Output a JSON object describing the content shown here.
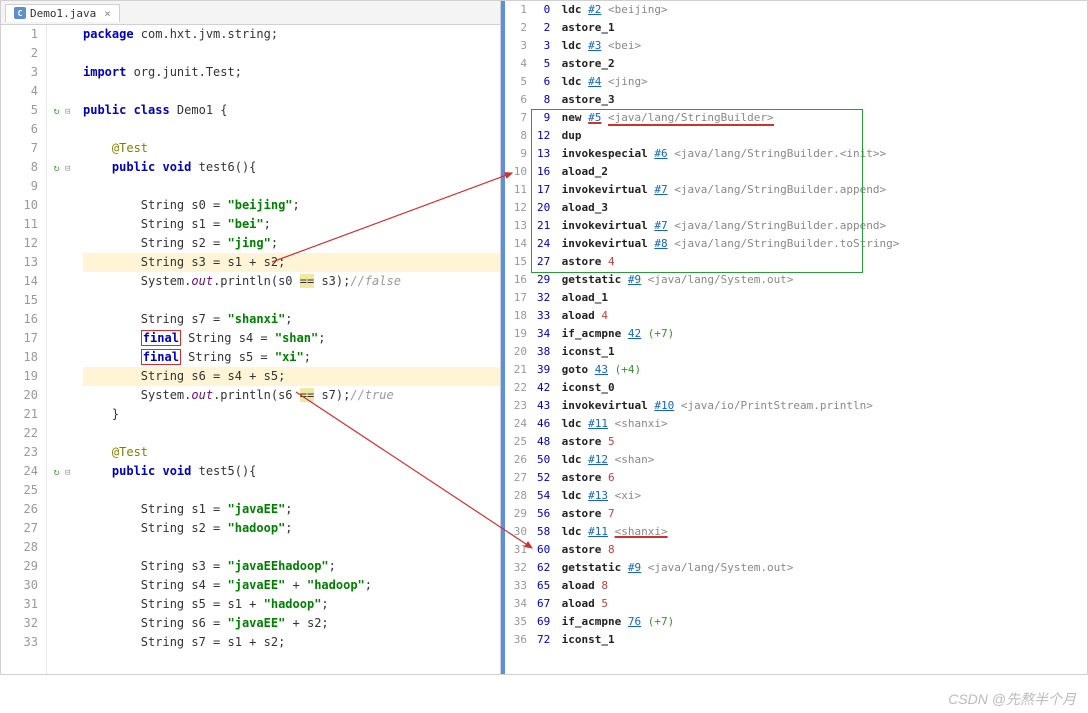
{
  "tab": {
    "filename": "Demo1.java"
  },
  "code": {
    "lines": [
      {
        "n": 1,
        "t": [
          [
            "kw",
            "package "
          ],
          [
            "",
            "com.hxt.jvm.string;"
          ]
        ]
      },
      {
        "n": 2,
        "t": [
          [
            "",
            ""
          ]
        ]
      },
      {
        "n": 3,
        "t": [
          [
            "kw",
            "import "
          ],
          [
            "",
            "org.junit.Test;"
          ]
        ]
      },
      {
        "n": 4,
        "t": [
          [
            "",
            ""
          ]
        ]
      },
      {
        "n": 5,
        "t": [
          [
            "kw",
            "public class "
          ],
          [
            "",
            "Demo1 {"
          ]
        ],
        "svc": true,
        "fold": true
      },
      {
        "n": 6,
        "t": [
          [
            "",
            ""
          ]
        ]
      },
      {
        "n": 7,
        "t": [
          [
            "",
            "    "
          ],
          [
            "ann",
            "@Test"
          ]
        ]
      },
      {
        "n": 8,
        "t": [
          [
            "",
            "    "
          ],
          [
            "kw",
            "public void "
          ],
          [
            "",
            "test6(){"
          ]
        ],
        "svc": true,
        "fold": true
      },
      {
        "n": 9,
        "t": [
          [
            "",
            ""
          ]
        ]
      },
      {
        "n": 10,
        "t": [
          [
            "",
            "        String s0 = "
          ],
          [
            "str",
            "\"beijing\""
          ],
          [
            "",
            ";"
          ]
        ]
      },
      {
        "n": 11,
        "t": [
          [
            "",
            "        String s1 = "
          ],
          [
            "str",
            "\"bei\""
          ],
          [
            "",
            ";"
          ]
        ]
      },
      {
        "n": 12,
        "t": [
          [
            "",
            "        String s2 = "
          ],
          [
            "str",
            "\"jing\""
          ],
          [
            "",
            ";"
          ]
        ]
      },
      {
        "n": 13,
        "t": [
          [
            "",
            "        String s3 = s1 + s2;"
          ]
        ],
        "hl": true
      },
      {
        "n": 14,
        "t": [
          [
            "",
            "        System."
          ],
          [
            "static-ita",
            "out"
          ],
          [
            "",
            ".println(s0 "
          ],
          [
            "eq",
            "=="
          ],
          [
            "",
            "",
            " s3);"
          ],
          [
            "comment",
            "//false"
          ]
        ]
      },
      {
        "n": 15,
        "t": [
          [
            "",
            ""
          ]
        ]
      },
      {
        "n": 16,
        "t": [
          [
            "",
            "        String s7 = "
          ],
          [
            "str",
            "\"shanxi\""
          ],
          [
            "",
            ";"
          ]
        ]
      },
      {
        "n": 17,
        "t": [
          [
            "",
            "        "
          ],
          [
            "finalbox",
            "final"
          ],
          [
            "",
            "",
            " String s4 = "
          ],
          [
            "str",
            "\"shan\""
          ],
          [
            "",
            ";"
          ]
        ]
      },
      {
        "n": 18,
        "t": [
          [
            "",
            "        "
          ],
          [
            "finalbox",
            "final"
          ],
          [
            "",
            "",
            " String s5 = "
          ],
          [
            "str",
            "\"xi\""
          ],
          [
            "",
            ";"
          ]
        ]
      },
      {
        "n": 19,
        "t": [
          [
            "",
            "        String s6 = s4 + s5;"
          ]
        ],
        "hl": true
      },
      {
        "n": 20,
        "t": [
          [
            "",
            "        System."
          ],
          [
            "static-ita",
            "out"
          ],
          [
            "",
            ".println(s6 "
          ],
          [
            "eq",
            "=="
          ],
          [
            "",
            "",
            " s7);"
          ],
          [
            "comment",
            "//true"
          ]
        ]
      },
      {
        "n": 21,
        "t": [
          [
            "",
            "    }"
          ]
        ]
      },
      {
        "n": 22,
        "t": [
          [
            "",
            ""
          ]
        ]
      },
      {
        "n": 23,
        "t": [
          [
            "",
            "    "
          ],
          [
            "ann",
            "@Test"
          ]
        ]
      },
      {
        "n": 24,
        "t": [
          [
            "",
            "    "
          ],
          [
            "kw",
            "public void "
          ],
          [
            "",
            "test5(){"
          ]
        ],
        "svc": true,
        "fold": true
      },
      {
        "n": 25,
        "t": [
          [
            "",
            ""
          ]
        ]
      },
      {
        "n": 26,
        "t": [
          [
            "",
            "        String s1 = "
          ],
          [
            "str",
            "\"javaEE\""
          ],
          [
            "",
            ";"
          ]
        ]
      },
      {
        "n": 27,
        "t": [
          [
            "",
            "        String s2 = "
          ],
          [
            "str",
            "\"hadoop\""
          ],
          [
            "",
            ";"
          ]
        ]
      },
      {
        "n": 28,
        "t": [
          [
            "",
            ""
          ]
        ]
      },
      {
        "n": 29,
        "t": [
          [
            "",
            "        String s3 = "
          ],
          [
            "str",
            "\"javaEEhadoop\""
          ],
          [
            "",
            ";"
          ]
        ]
      },
      {
        "n": 30,
        "t": [
          [
            "",
            "        String s4 = "
          ],
          [
            "str",
            "\"javaEE\""
          ],
          [
            "",
            "",
            " + "
          ],
          [
            "str",
            "\"hadoop\""
          ],
          [
            "",
            ";"
          ]
        ]
      },
      {
        "n": 31,
        "t": [
          [
            "",
            "        String s5 = s1 + "
          ],
          [
            "str",
            "\"hadoop\""
          ],
          [
            "",
            ";"
          ]
        ]
      },
      {
        "n": 32,
        "t": [
          [
            "",
            "        String s6 = "
          ],
          [
            "str",
            "\"javaEE\""
          ],
          [
            "",
            "",
            " + s2;"
          ]
        ]
      },
      {
        "n": 33,
        "t": [
          [
            "",
            "        String s7 = s1 + s2;"
          ]
        ]
      }
    ]
  },
  "bytecode": {
    "lines": [
      {
        "n": 1,
        "num": "0",
        "op": "ldc",
        "ref": "#2",
        "desc": "<beijing>"
      },
      {
        "n": 2,
        "num": "2",
        "op": "astore_1"
      },
      {
        "n": 3,
        "num": "3",
        "op": "ldc",
        "ref": "#3",
        "desc": "<bei>"
      },
      {
        "n": 4,
        "num": "5",
        "op": "astore_2"
      },
      {
        "n": 5,
        "num": "6",
        "op": "ldc",
        "ref": "#4",
        "desc": "<jing>"
      },
      {
        "n": 6,
        "num": "8",
        "op": "astore_3"
      },
      {
        "n": 7,
        "num": "9",
        "op": "new",
        "ref": "#5",
        "desc": "<java/lang/StringBuilder>",
        "redUL": true
      },
      {
        "n": 8,
        "num": "12",
        "op": "dup"
      },
      {
        "n": 9,
        "num": "13",
        "op": "invokespecial",
        "ref": "#6",
        "desc": "<java/lang/StringBuilder.<init>>"
      },
      {
        "n": 10,
        "num": "16",
        "op": "aload_2"
      },
      {
        "n": 11,
        "num": "17",
        "op": "invokevirtual",
        "ref": "#7",
        "desc": "<java/lang/StringBuilder.append>"
      },
      {
        "n": 12,
        "num": "20",
        "op": "aload_3"
      },
      {
        "n": 13,
        "num": "21",
        "op": "invokevirtual",
        "ref": "#7",
        "desc": "<java/lang/StringBuilder.append>"
      },
      {
        "n": 14,
        "num": "24",
        "op": "invokevirtual",
        "ref": "#8",
        "desc": "<java/lang/StringBuilder.toString>"
      },
      {
        "n": 15,
        "num": "27",
        "op": "astore",
        "operand": "4"
      },
      {
        "n": 16,
        "num": "29",
        "op": "getstatic",
        "ref": "#9",
        "desc": "<java/lang/System.out>"
      },
      {
        "n": 17,
        "num": "32",
        "op": "aload_1"
      },
      {
        "n": 18,
        "num": "33",
        "op": "aload",
        "operand": "4"
      },
      {
        "n": 19,
        "num": "34",
        "op": "if_acmpne",
        "ref": "42",
        "green": "(+7)"
      },
      {
        "n": 20,
        "num": "38",
        "op": "iconst_1"
      },
      {
        "n": 21,
        "num": "39",
        "op": "goto",
        "ref": "43",
        "green": "(+4)"
      },
      {
        "n": 22,
        "num": "42",
        "op": "iconst_0"
      },
      {
        "n": 23,
        "num": "43",
        "op": "invokevirtual",
        "ref": "#10",
        "desc": "<java/io/PrintStream.println>"
      },
      {
        "n": 24,
        "num": "46",
        "op": "ldc",
        "ref": "#11",
        "desc": "<shanxi>"
      },
      {
        "n": 25,
        "num": "48",
        "op": "astore",
        "operand": "5"
      },
      {
        "n": 26,
        "num": "50",
        "op": "ldc",
        "ref": "#12",
        "desc": "<shan>"
      },
      {
        "n": 27,
        "num": "52",
        "op": "astore",
        "operand": "6"
      },
      {
        "n": 28,
        "num": "54",
        "op": "ldc",
        "ref": "#13",
        "desc": "<xi>"
      },
      {
        "n": 29,
        "num": "56",
        "op": "astore",
        "operand": "7"
      },
      {
        "n": 30,
        "num": "58",
        "op": "ldc",
        "ref": "#11",
        "desc": "<shanxi>",
        "redUL2": true
      },
      {
        "n": 31,
        "num": "60",
        "op": "astore",
        "operand": "8"
      },
      {
        "n": 32,
        "num": "62",
        "op": "getstatic",
        "ref": "#9",
        "desc": "<java/lang/System.out>"
      },
      {
        "n": 33,
        "num": "65",
        "op": "aload",
        "operand": "8"
      },
      {
        "n": 34,
        "num": "67",
        "op": "aload",
        "operand": "5"
      },
      {
        "n": 35,
        "num": "69",
        "op": "if_acmpne",
        "ref": "76",
        "green": "(+7)"
      },
      {
        "n": 36,
        "num": "72",
        "op": "iconst_1"
      }
    ]
  },
  "watermark": "CSDN @先熬半个月"
}
